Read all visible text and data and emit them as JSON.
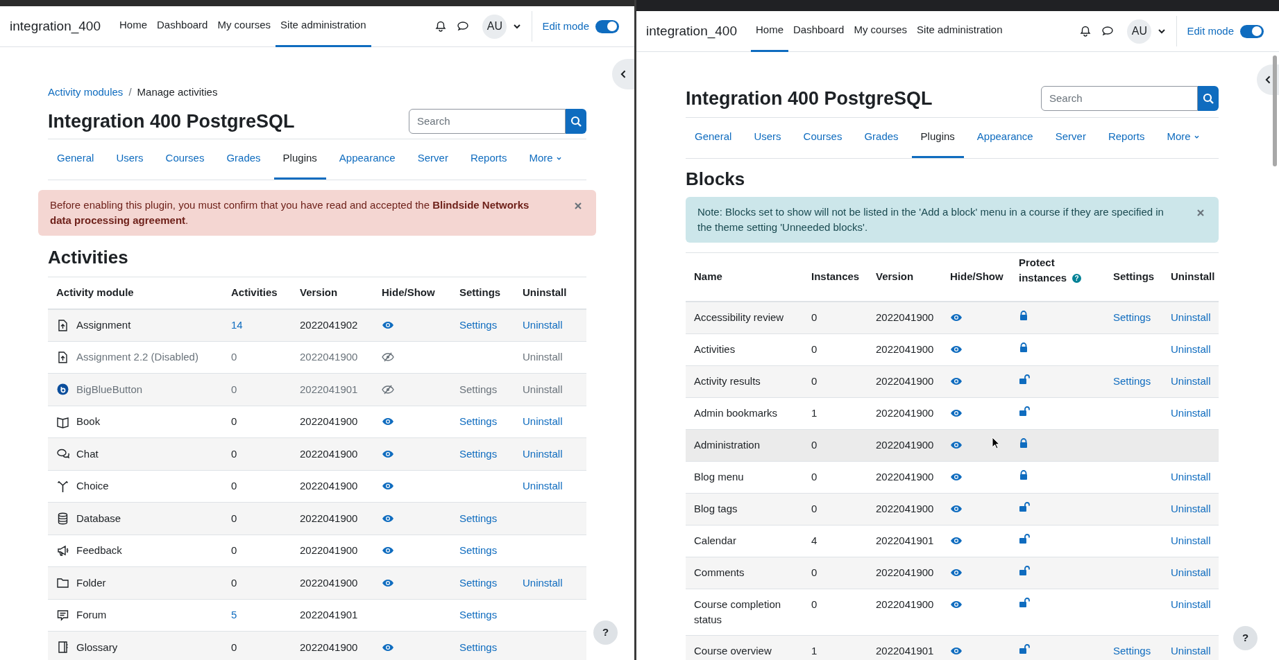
{
  "left_window": {
    "navbar": {
      "brand": "integration_400",
      "links": [
        {
          "label": "Home",
          "selected": false
        },
        {
          "label": "Dashboard",
          "selected": false
        },
        {
          "label": "My courses",
          "selected": false
        },
        {
          "label": "Site administration",
          "selected": true
        }
      ],
      "avatar": "AU",
      "edit_mode": {
        "label": "Edit mode",
        "on": true
      }
    },
    "breadcrumb": [
      {
        "label": "Activity modules",
        "link": true
      },
      {
        "label": "Manage activities",
        "link": false
      }
    ],
    "breadcrumb_separator": "/",
    "heading": "Integration 400 PostgreSQL",
    "search": {
      "placeholder": "Search"
    },
    "tabs": [
      {
        "label": "General",
        "selected": false,
        "dropdown": false
      },
      {
        "label": "Users",
        "selected": false,
        "dropdown": false
      },
      {
        "label": "Courses",
        "selected": false,
        "dropdown": false
      },
      {
        "label": "Grades",
        "selected": false,
        "dropdown": false
      },
      {
        "label": "Plugins",
        "selected": true,
        "dropdown": false
      },
      {
        "label": "Appearance",
        "selected": false,
        "dropdown": false
      },
      {
        "label": "Server",
        "selected": false,
        "dropdown": false
      },
      {
        "label": "Reports",
        "selected": false,
        "dropdown": false
      },
      {
        "label": "More",
        "selected": false,
        "dropdown": true
      }
    ],
    "alert": {
      "kind": "danger",
      "text": "Before enabling this plugin, you must confirm that you have read and accepted the **Blindside Networks data processing agreement**."
    },
    "section_title": "Activities",
    "table": {
      "columns": [
        "Activity module",
        "Activities",
        "Version",
        "Hide/Show",
        "Settings",
        "Uninstall"
      ],
      "rows": [
        {
          "kind": "assignment",
          "name": "Assignment",
          "disabled": false,
          "count": "14",
          "count_link": true,
          "version": "2022041902",
          "visible": true,
          "settings": "Settings",
          "uninstall": "Uninstall"
        },
        {
          "kind": "assignment",
          "name": "Assignment 2.2 (Disabled)",
          "disabled": true,
          "count": "0",
          "count_link": false,
          "version": "2022041900",
          "visible": false,
          "uninstall": "Uninstall"
        },
        {
          "kind": "conference",
          "name": "BigBlueButton",
          "disabled": true,
          "count": "0",
          "count_link": false,
          "version": "2022041901",
          "visible": false,
          "settings": "Settings",
          "uninstall": "Uninstall"
        },
        {
          "kind": "book",
          "name": "Book",
          "disabled": false,
          "count": "0",
          "count_link": false,
          "version": "2022041900",
          "visible": true,
          "settings": "Settings",
          "uninstall": "Uninstall"
        },
        {
          "kind": "chat",
          "name": "Chat",
          "disabled": false,
          "count": "0",
          "count_link": false,
          "version": "2022041900",
          "visible": true,
          "settings": "Settings",
          "uninstall": "Uninstall"
        },
        {
          "kind": "choice",
          "name": "Choice",
          "disabled": false,
          "count": "0",
          "count_link": false,
          "version": "2022041900",
          "visible": true,
          "uninstall": "Uninstall"
        },
        {
          "kind": "database",
          "name": "Database",
          "disabled": false,
          "count": "0",
          "count_link": false,
          "version": "2022041900",
          "visible": true,
          "settings": "Settings"
        },
        {
          "kind": "feedback",
          "name": "Feedback",
          "disabled": false,
          "count": "0",
          "count_link": false,
          "version": "2022041900",
          "visible": true,
          "settings": "Settings"
        },
        {
          "kind": "folder",
          "name": "Folder",
          "disabled": false,
          "count": "0",
          "count_link": false,
          "version": "2022041900",
          "visible": true,
          "settings": "Settings",
          "uninstall": "Uninstall"
        },
        {
          "kind": "forum",
          "name": "Forum",
          "disabled": false,
          "count": "5",
          "count_link": true,
          "version": "2022041901",
          "settings": "Settings"
        },
        {
          "kind": "glossary",
          "name": "Glossary",
          "disabled": false,
          "count": "0",
          "count_link": false,
          "version": "2022041900",
          "visible": true,
          "settings": "Settings"
        }
      ]
    },
    "help_button": "?"
  },
  "right_window": {
    "navbar": {
      "brand": "integration_400",
      "links": [
        {
          "label": "Home",
          "selected": true
        },
        {
          "label": "Dashboard",
          "selected": false
        },
        {
          "label": "My courses",
          "selected": false
        },
        {
          "label": "Site administration",
          "selected": false
        }
      ],
      "avatar": "AU",
      "edit_mode": {
        "label": "Edit mode",
        "on": true
      }
    },
    "heading": "Integration 400 PostgreSQL",
    "search": {
      "placeholder": "Search"
    },
    "tabs": [
      {
        "label": "General",
        "selected": false,
        "dropdown": false
      },
      {
        "label": "Users",
        "selected": false,
        "dropdown": false
      },
      {
        "label": "Courses",
        "selected": false,
        "dropdown": false
      },
      {
        "label": "Grades",
        "selected": false,
        "dropdown": false
      },
      {
        "label": "Plugins",
        "selected": true,
        "dropdown": false
      },
      {
        "label": "Appearance",
        "selected": false,
        "dropdown": false
      },
      {
        "label": "Server",
        "selected": false,
        "dropdown": false
      },
      {
        "label": "Reports",
        "selected": false,
        "dropdown": false
      },
      {
        "label": "More",
        "selected": false,
        "dropdown": true
      }
    ],
    "section_title": "Blocks",
    "alert": {
      "kind": "info",
      "text": "Note: Blocks set to show will not be listed in the 'Add a block' menu in a course if they are specified in the theme setting 'Unneeded blocks'."
    },
    "table": {
      "columns": [
        "Name",
        "Instances",
        "Version",
        "Hide/Show",
        "Protect instances",
        "Settings",
        "Uninstall"
      ],
      "column_help": "?",
      "rows": [
        {
          "name": "Accessibility review",
          "instances": "0",
          "version": "2022041900",
          "locked": true,
          "settings": "Settings",
          "uninstall": "Uninstall",
          "hovered": false
        },
        {
          "name": "Activities",
          "instances": "0",
          "version": "2022041900",
          "locked": true,
          "uninstall": "Uninstall",
          "hovered": false
        },
        {
          "name": "Activity results",
          "instances": "0",
          "version": "2022041900",
          "locked": false,
          "settings": "Settings",
          "uninstall": "Uninstall",
          "hovered": false
        },
        {
          "name": "Admin bookmarks",
          "instances": "1",
          "version": "2022041900",
          "locked": false,
          "uninstall": "Uninstall",
          "hovered": false
        },
        {
          "name": "Administration",
          "instances": "0",
          "version": "2022041900",
          "locked": true,
          "hovered": true
        },
        {
          "name": "Blog menu",
          "instances": "0",
          "version": "2022041900",
          "locked": true,
          "uninstall": "Uninstall",
          "hovered": false
        },
        {
          "name": "Blog tags",
          "instances": "0",
          "version": "2022041900",
          "locked": false,
          "uninstall": "Uninstall",
          "hovered": false
        },
        {
          "name": "Calendar",
          "instances": "4",
          "version": "2022041901",
          "locked": false,
          "uninstall": "Uninstall",
          "hovered": false
        },
        {
          "name": "Comments",
          "instances": "0",
          "version": "2022041900",
          "locked": false,
          "uninstall": "Uninstall",
          "hovered": false
        },
        {
          "name": "Course completion status",
          "instances": "0",
          "version": "2022041900",
          "locked": false,
          "uninstall": "Uninstall",
          "hovered": false
        },
        {
          "name": "Course overview",
          "instances": "1",
          "version": "2022041901",
          "locked": false,
          "settings": "Settings",
          "uninstall": "Uninstall",
          "hovered": false
        }
      ]
    },
    "help_button": "?"
  }
}
